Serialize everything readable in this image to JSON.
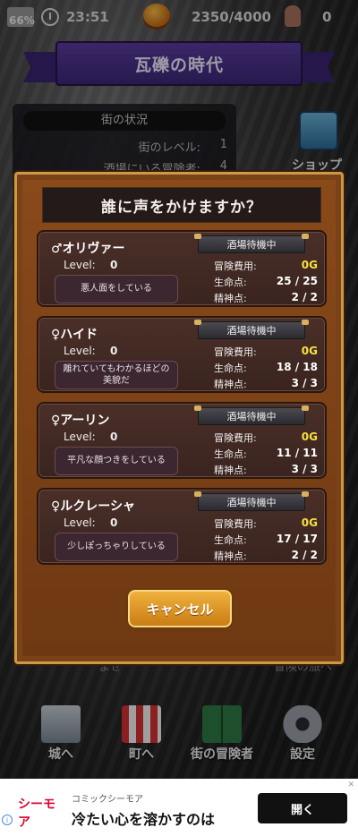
{
  "status": {
    "battery": "66%",
    "time": "23:51",
    "gold": "2350/4000",
    "heroes": "0"
  },
  "title": "瓦礫の時代",
  "town": {
    "header": "街の状況",
    "rows": [
      {
        "label": "街のレベル:",
        "value": "1"
      },
      {
        "label": "酒場にいる冒険者:",
        "value": "4"
      }
    ]
  },
  "shop_label": "ショップ",
  "dialog": {
    "title": "誰に声をかけますか？",
    "level_label": "Level:",
    "cost_label": "冒険費用:",
    "hp_label": "生命点:",
    "mp_label": "精神点:",
    "cancel_label": "キャンセル",
    "adventurers": [
      {
        "name": "♂オリヴァー",
        "level": "0",
        "status": "酒場待機中",
        "cost": "0G",
        "hp": "25 / 25",
        "mp": "2 / 2",
        "desc": "悪人面をしている"
      },
      {
        "name": "♀ハイド",
        "level": "0",
        "status": "酒場待機中",
        "cost": "0G",
        "hp": "18 / 18",
        "mp": "3 / 3",
        "desc": "離れていてもわかるほどの美貌だ"
      },
      {
        "name": "♀アーリン",
        "level": "0",
        "status": "酒場待機中",
        "cost": "0G",
        "hp": "11 / 11",
        "mp": "3 / 3",
        "desc": "平凡な顔つきをしている"
      },
      {
        "name": "♀ルクレーシャ",
        "level": "0",
        "status": "酒場待機中",
        "cost": "0G",
        "hp": "17 / 17",
        "mp": "2 / 2",
        "desc": "少しぽっちゃりしている"
      }
    ]
  },
  "behind": {
    "left": "ませ    ",
    "right": "冒険の旅へ"
  },
  "nav": [
    {
      "label": "城へ",
      "icon": "castle-icon"
    },
    {
      "label": "町へ",
      "icon": "shop-awning-icon"
    },
    {
      "label": "街の冒険者",
      "icon": "book-icon"
    },
    {
      "label": "設定",
      "icon": "gear-icon"
    }
  ],
  "ad": {
    "logo": "シーモア",
    "sub": "コミックシーモア",
    "headline": "冷たい心を溶かすのは",
    "button": "開く"
  },
  "colors": {
    "gold": "#f8e040",
    "modal": "#7a4216",
    "banner": "#4a2f88"
  }
}
